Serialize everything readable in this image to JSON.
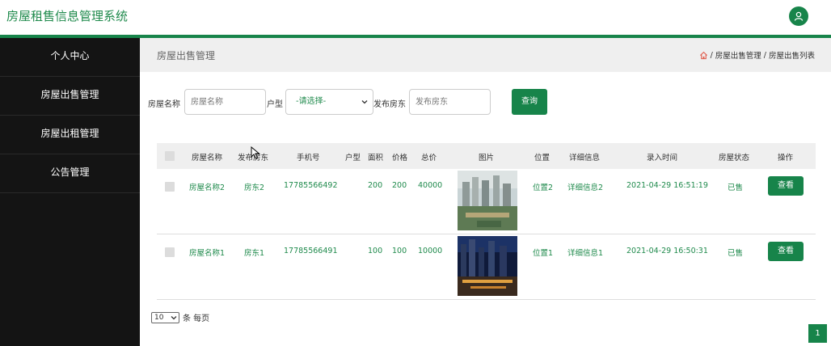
{
  "header": {
    "app_title": "房屋租售信息管理系统",
    "avatar_icon": "user-icon",
    "accent": "#17844a"
  },
  "sidebar": {
    "items": [
      {
        "label": "个人中心"
      },
      {
        "label": "房屋出售管理"
      },
      {
        "label": "房屋出租管理"
      },
      {
        "label": "公告管理"
      }
    ]
  },
  "page": {
    "title": "房屋出售管理",
    "breadcrumb": {
      "home_icon": "home-icon",
      "sep": "/",
      "items": [
        "房屋出售管理",
        "房屋出售列表"
      ]
    }
  },
  "search": {
    "name_label": "房屋名称",
    "name_placeholder": "房屋名称",
    "type_label": "户型",
    "type_selected": "-请选择-",
    "owner_label": "发布房东",
    "owner_placeholder": "发布房东",
    "query_button": "查询"
  },
  "table": {
    "headers": [
      "房屋名称",
      "发布房东",
      "手机号",
      "户型",
      "面积",
      "价格",
      "总价",
      "图片",
      "位置",
      "详细信息",
      "录入时间",
      "房屋状态",
      "操作"
    ],
    "rows": [
      {
        "name": "房屋名称2",
        "owner": "房东2",
        "phone": "17785566492",
        "type": "",
        "area": "200",
        "price": "200",
        "total": "40000",
        "location": "位置2",
        "detail": "详细信息2",
        "time": "2021-04-29 16:51:19",
        "status": "已售",
        "action": "查看"
      },
      {
        "name": "房屋名称1",
        "owner": "房东1",
        "phone": "17785566491",
        "type": "",
        "area": "100",
        "price": "100",
        "total": "10000",
        "location": "位置1",
        "detail": "详细信息1",
        "time": "2021-04-29 16:50:31",
        "status": "已售",
        "action": "查看"
      }
    ]
  },
  "pagination": {
    "page_size": "10",
    "per_page_label": "条 每页",
    "current_page": "1"
  }
}
